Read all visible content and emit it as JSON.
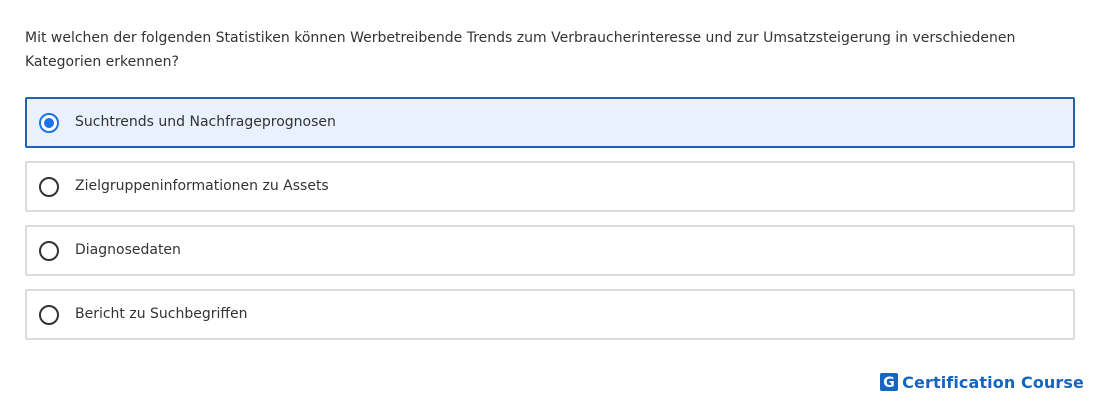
{
  "question": {
    "text": "Mit welchen der folgenden Statistiken können Werbetreibende Trends zum Verbraucherinteresse und zur Umsatzsteigerung in verschiedenen Kategorien erkennen?"
  },
  "options": [
    {
      "label": "Suchtrends und Nachfrageprognosen",
      "selected": true
    },
    {
      "label": "Zielgruppeninformationen zu Assets",
      "selected": false
    },
    {
      "label": "Diagnosedaten",
      "selected": false
    },
    {
      "label": "Bericht zu Suchbegriffen",
      "selected": false
    }
  ],
  "brand": {
    "logo_letter": "G",
    "text": "Certification Course",
    "color": "#1665c0"
  },
  "colors": {
    "selected_border": "#1d63b8",
    "selected_background": "#e8f1fd",
    "radio_accent": "#1a73e8",
    "unselected_border": "#dcdcdc"
  }
}
